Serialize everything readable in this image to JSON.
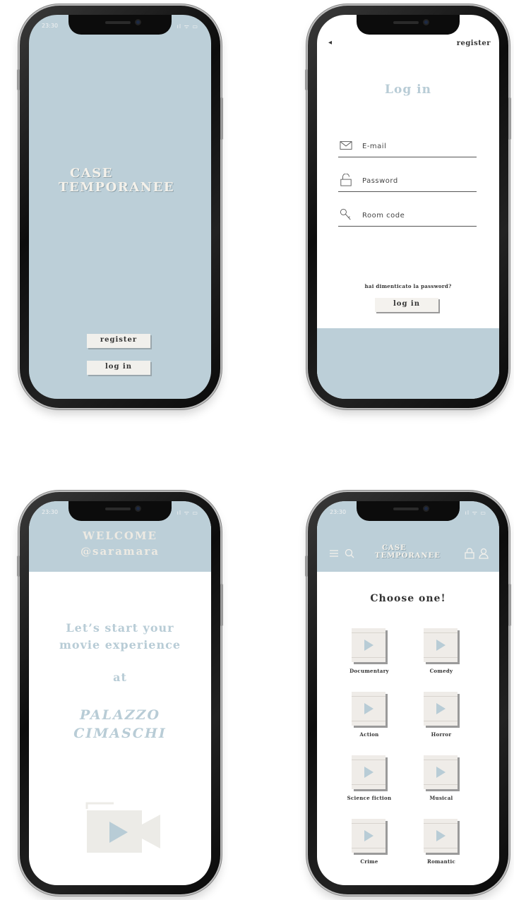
{
  "status": {
    "time": "23:30",
    "icons": "ıl ᯤ ▭"
  },
  "splash": {
    "logo_line1": "CASE",
    "logo_line2": "TEMPORANEE",
    "register_label": "register",
    "login_label": "log in"
  },
  "login": {
    "back_glyph": "◂",
    "register_link": "register",
    "title": "Log in",
    "email_placeholder": "E-mail",
    "password_placeholder": "Password",
    "room_code_placeholder": "Room code",
    "forgot_password": "hai dimenticato la password?",
    "login_button": "log in"
  },
  "welcome": {
    "line1": "WELCOME",
    "line2": "@saramara",
    "text1": "Let’s start your",
    "text2": "movie experience",
    "text3": "at",
    "venue1": "PALAZZO",
    "venue2": "CIMASCHI"
  },
  "genres": {
    "logo_line1": "CASE",
    "logo_line2": "TEMPORANEE",
    "title": "Choose one!",
    "items": [
      {
        "label": "Documentary"
      },
      {
        "label": "Comedy"
      },
      {
        "label": "Action"
      },
      {
        "label": "Horror"
      },
      {
        "label": "Science fiction"
      },
      {
        "label": "Musical"
      },
      {
        "label": "Crime"
      },
      {
        "label": "Romantic"
      }
    ]
  },
  "colors": {
    "accent": "#bccfd8",
    "button": "#f1f0ec",
    "text": "#333333"
  }
}
